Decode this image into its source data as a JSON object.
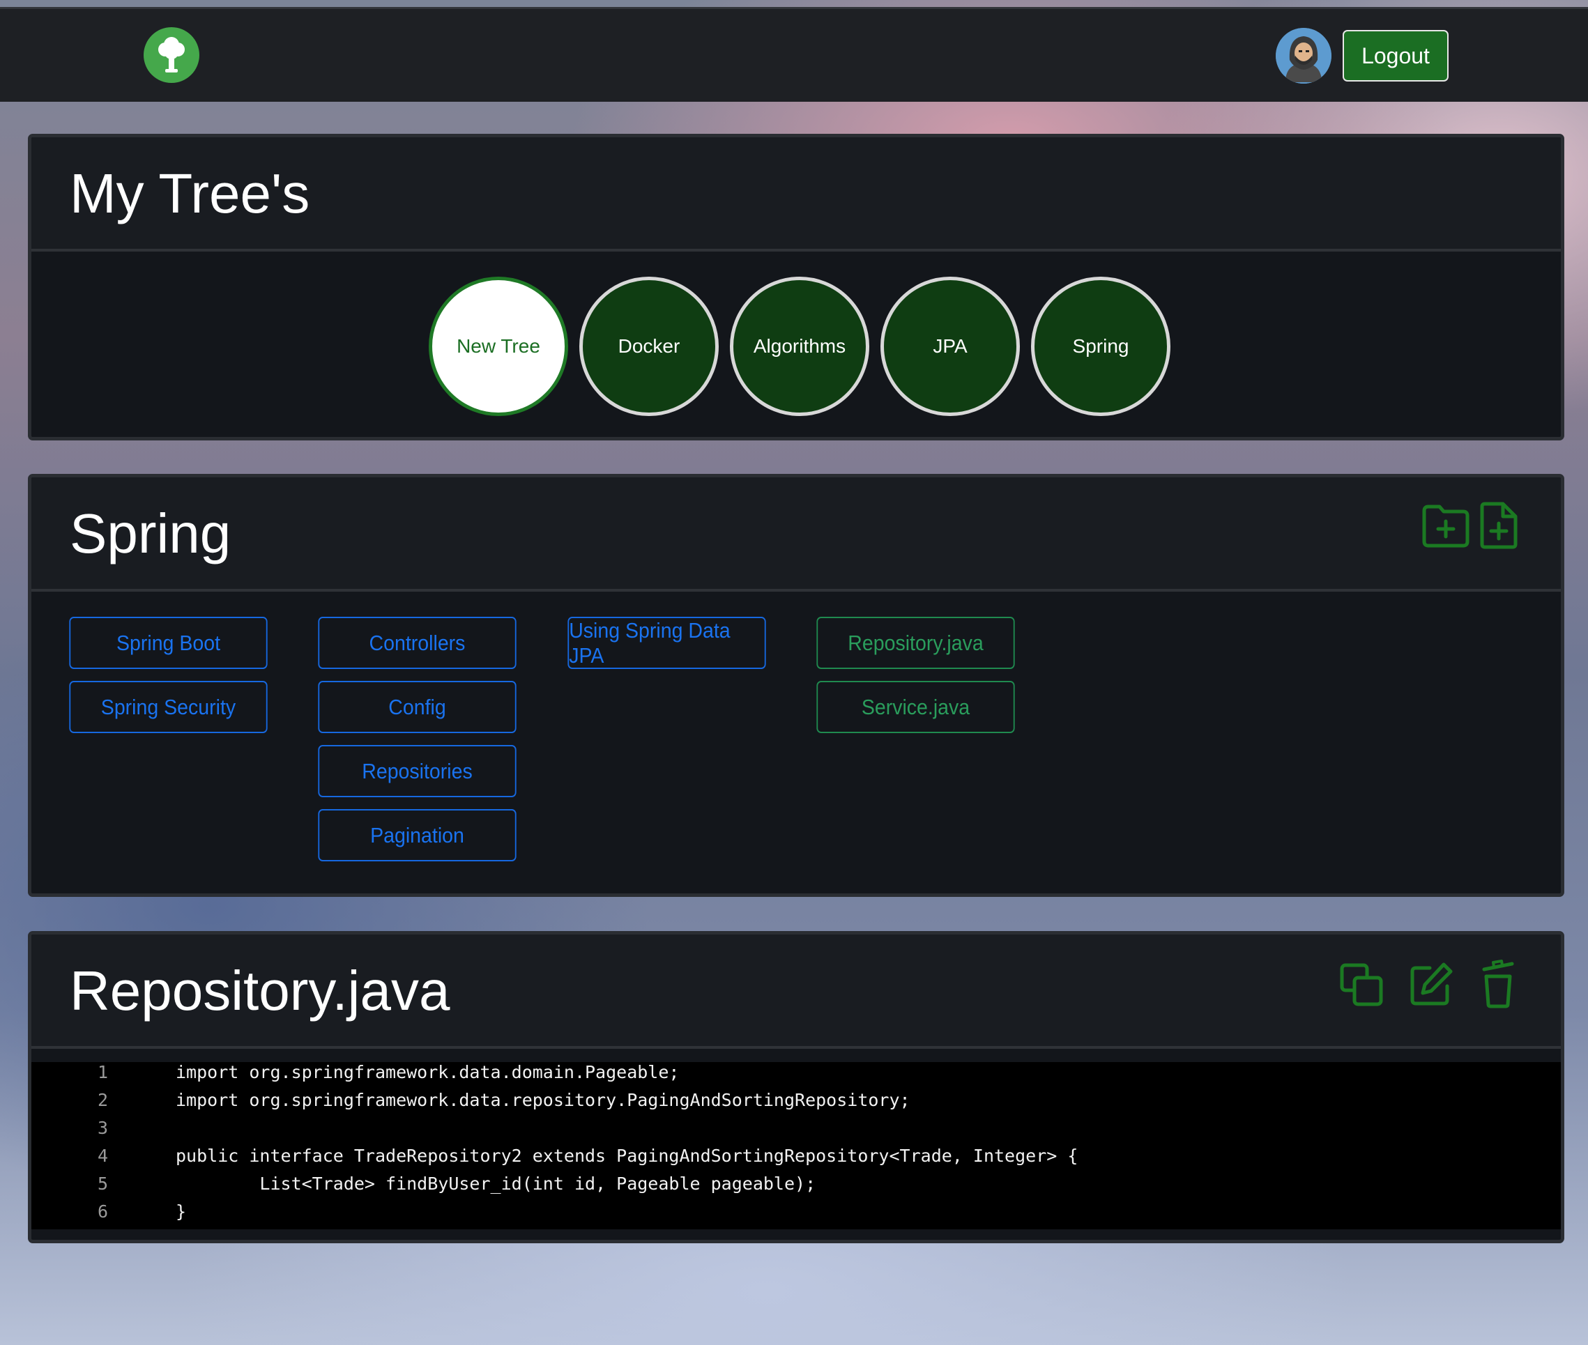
{
  "navbar": {
    "logo_icon": "tree-icon",
    "avatar_icon": "user-avatar",
    "logout_label": "Logout"
  },
  "trees_card": {
    "title": "My Tree's",
    "trees": [
      {
        "label": "New Tree",
        "selected": false
      },
      {
        "label": "Docker",
        "selected": false
      },
      {
        "label": "Algorithms",
        "selected": false
      },
      {
        "label": "JPA",
        "selected": false
      },
      {
        "label": "Spring",
        "selected": false
      }
    ]
  },
  "folder_card": {
    "title": "Spring",
    "actions": [
      "new-folder-icon",
      "new-file-icon"
    ],
    "columns": [
      {
        "folders": [
          "Spring Boot",
          "Spring Security"
        ]
      },
      {
        "folders": [
          "Controllers",
          "Config",
          "Repositories",
          "Pagination"
        ]
      },
      {
        "folders": [
          "Using Spring Data JPA"
        ]
      },
      {
        "files": [
          "Repository.java",
          "Service.java"
        ]
      }
    ]
  },
  "file_card": {
    "title": "Repository.java",
    "actions": [
      "copy-icon",
      "edit-icon",
      "delete-icon"
    ],
    "code_lines": [
      {
        "number": "1",
        "text": "import org.springframework.data.domain.Pageable;"
      },
      {
        "number": "2",
        "text": "import org.springframework.data.repository.PagingAndSortingRepository;"
      },
      {
        "number": "3",
        "text": ""
      },
      {
        "number": "4",
        "text": "public interface TradeRepository2 extends PagingAndSortingRepository<Trade, Integer> {"
      },
      {
        "number": "5",
        "text": "        List<Trade> findByUser_id(int id, Pageable pageable);"
      },
      {
        "number": "6",
        "text": "}"
      }
    ]
  },
  "colors": {
    "accent_green": "#1b6e23",
    "folder_blue": "#1a73f0",
    "file_green": "#2a9d5c",
    "card_bg": "#13161b"
  }
}
